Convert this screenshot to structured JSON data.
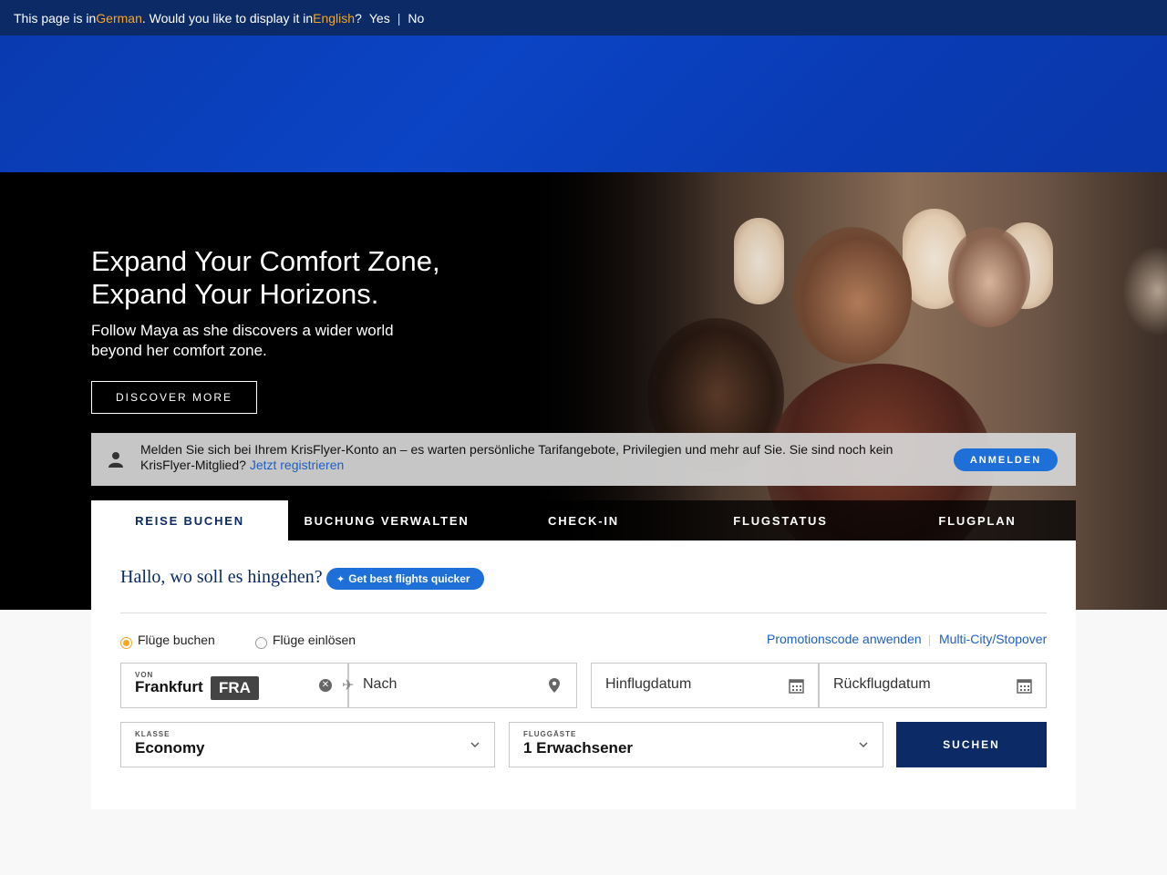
{
  "translate_bar": {
    "prefix": "This page is in ",
    "source_lang": "German",
    "middle": ". Would you like to display it in ",
    "target_lang": "English",
    "suffix": "?",
    "yes": "Yes",
    "separator": "|",
    "no": "No"
  },
  "hero": {
    "title_line1": "Expand Your Comfort Zone,",
    "title_line2": "Expand Your Horizons.",
    "subtitle_line1": "Follow Maya as she discovers a wider world",
    "subtitle_line2": "beyond her comfort zone.",
    "cta": "DISCOVER MORE"
  },
  "login_banner": {
    "message": "Melden Sie sich bei Ihrem KrisFlyer-Konto an – es warten persönliche Tarifangebote, Privilegien und mehr auf Sie. Sie sind noch kein KrisFlyer-Mitglied? ",
    "register_link": "Jetzt registrieren",
    "login_button": "ANMELDEN"
  },
  "tabs": [
    {
      "label": "REISE BUCHEN",
      "active": true
    },
    {
      "label": "BUCHUNG VERWALTEN",
      "active": false
    },
    {
      "label": "CHECK-IN",
      "active": false
    },
    {
      "label": "FLUGSTATUS",
      "active": false
    },
    {
      "label": "FLUGPLAN",
      "active": false
    }
  ],
  "booking": {
    "greeting": "Hallo, wo soll es hingehen?",
    "ai_pill": "Get best flights quicker",
    "radio_book": "Flüge buchen",
    "radio_redeem": "Flüge einlösen",
    "promo_link": "Promotionscode anwenden",
    "multicity_link": "Multi-City/Stopover",
    "from_label": "VON",
    "from_city": "Frankfurt",
    "from_code": "FRA",
    "to_placeholder": "Nach",
    "depart_placeholder": "Hinflugdatum",
    "return_placeholder": "Rückflugdatum",
    "class_label": "KLASSE",
    "class_value": "Economy",
    "pax_label": "FLUGGÄSTE",
    "pax_value": "1 Erwachsener",
    "search_button": "SUCHEN"
  },
  "colors": {
    "navy": "#0b2a66",
    "accent_blue": "#1f6fd8",
    "highlight_orange": "#f5a623"
  }
}
